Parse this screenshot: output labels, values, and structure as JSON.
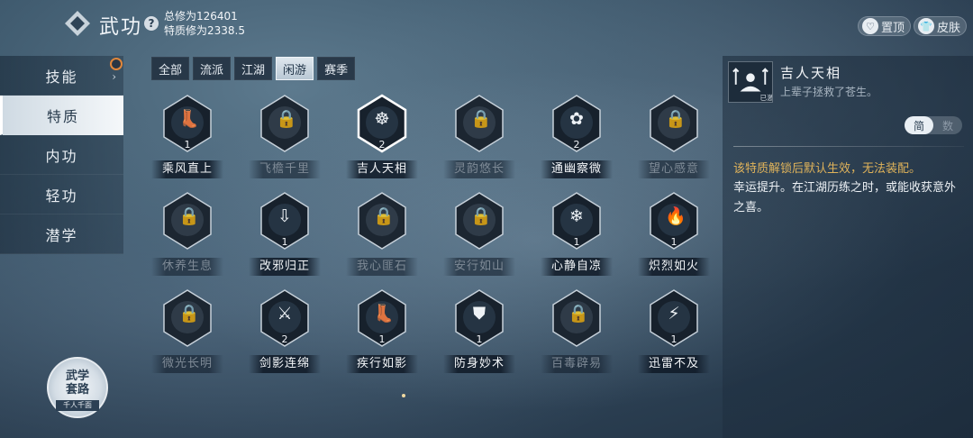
{
  "header": {
    "title": "武功",
    "help": "?",
    "total_cultivation": "总修为126401",
    "trait_cultivation": "特质修为2338.5",
    "pin_label": "置顶",
    "skin_label": "皮肤"
  },
  "sidebar": {
    "items": [
      {
        "label": "技能"
      },
      {
        "label": "特质"
      },
      {
        "label": "内功"
      },
      {
        "label": "轻功"
      },
      {
        "label": "潜学"
      }
    ],
    "active": 1
  },
  "tabs": [
    {
      "label": "全部"
    },
    {
      "label": "流派"
    },
    {
      "label": "江湖"
    },
    {
      "label": "闲游"
    },
    {
      "label": "赛季"
    }
  ],
  "active_tab": 3,
  "traits": [
    {
      "name": "乘风直上",
      "level": "1",
      "locked": false,
      "icon": "boot-icon"
    },
    {
      "name": "飞檐千里",
      "level": "",
      "locked": true,
      "icon": "lock-icon"
    },
    {
      "name": "吉人天相",
      "level": "2",
      "locked": false,
      "icon": "meditate-icon",
      "selected": true
    },
    {
      "name": "灵韵悠长",
      "level": "",
      "locked": true,
      "icon": "lock-icon"
    },
    {
      "name": "通幽察微",
      "level": "2",
      "locked": false,
      "icon": "lotus-icon"
    },
    {
      "name": "望心感意",
      "level": "",
      "locked": true,
      "icon": "lock-icon"
    },
    {
      "name": "休养生息",
      "level": "",
      "locked": true,
      "icon": "lock-icon"
    },
    {
      "name": "改邪归正",
      "level": "1",
      "locked": false,
      "icon": "arrow-down-icon"
    },
    {
      "name": "我心匪石",
      "level": "",
      "locked": true,
      "icon": "lock-icon"
    },
    {
      "name": "安行如山",
      "level": "",
      "locked": true,
      "icon": "lock-icon"
    },
    {
      "name": "心静自凉",
      "level": "1",
      "locked": false,
      "icon": "snowflake-icon"
    },
    {
      "name": "炽烈如火",
      "level": "1",
      "locked": false,
      "icon": "fire-icon"
    },
    {
      "name": "微光长明",
      "level": "",
      "locked": true,
      "icon": "lock-icon"
    },
    {
      "name": "剑影连绵",
      "level": "2",
      "locked": false,
      "icon": "sword-icon"
    },
    {
      "name": "疾行如影",
      "level": "1",
      "locked": false,
      "icon": "boot-icon"
    },
    {
      "name": "防身妙术",
      "level": "1",
      "locked": false,
      "icon": "shield-icon"
    },
    {
      "name": "百毒辟易",
      "level": "",
      "locked": true,
      "icon": "lock-icon"
    },
    {
      "name": "迅雷不及",
      "level": "1",
      "locked": false,
      "icon": "lightning-icon"
    }
  ],
  "detail": {
    "name": "吉人天相",
    "subtitle": "上辈子拯救了苍生。",
    "toggle_simple": "简",
    "toggle_numbers": "数",
    "warning": "该特质解锁后默认生效，无法装配。",
    "description": "幸运提升。在江湖历练之时，或能收获意外之喜。",
    "icon_tag": "已激"
  },
  "martial_set": {
    "title_line1": "武学",
    "title_line2": "套路",
    "sub": "千人千面"
  }
}
